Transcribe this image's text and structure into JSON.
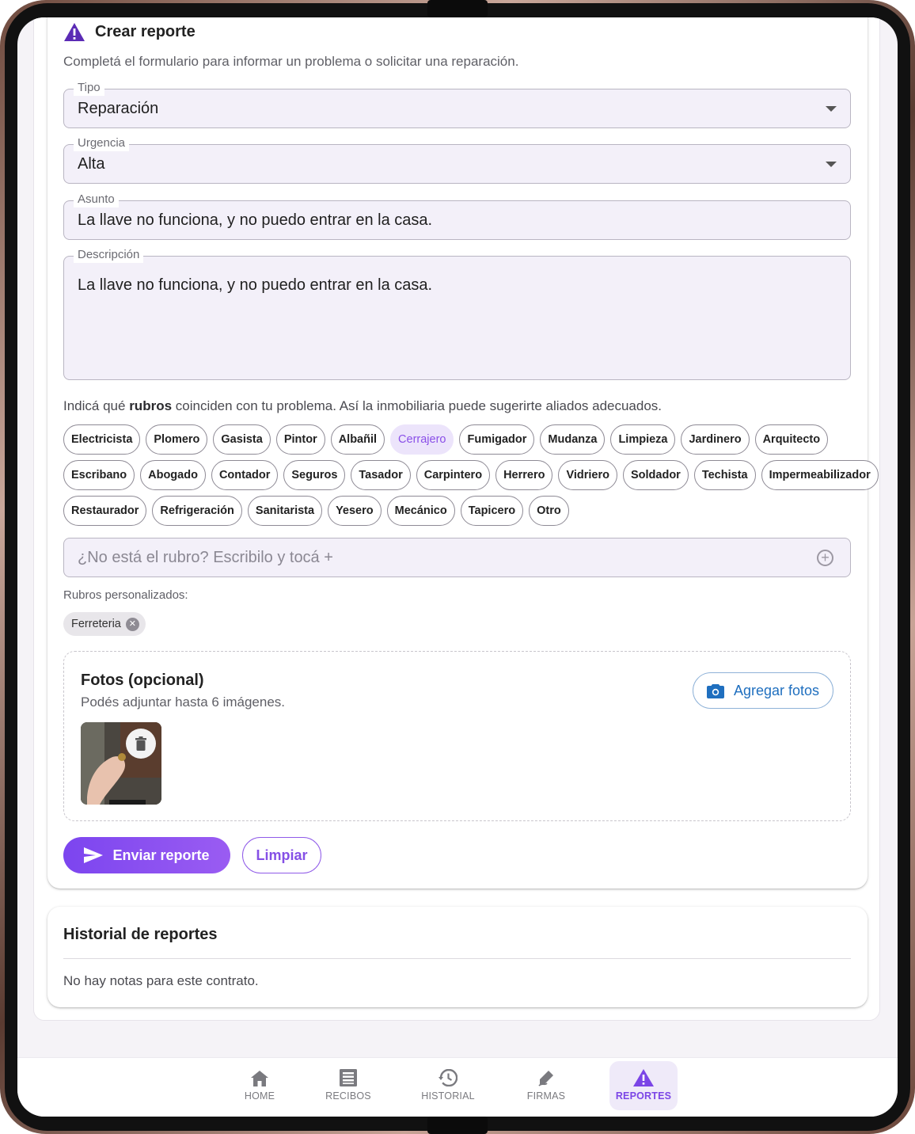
{
  "form": {
    "title": "Crear reporte",
    "subtitle": "Completá el formulario para informar un problema o solicitar una reparación.",
    "tipo": {
      "label": "Tipo",
      "value": "Reparación"
    },
    "urgencia": {
      "label": "Urgencia",
      "value": "Alta"
    },
    "asunto": {
      "label": "Asunto",
      "value": "La llave no funciona, y no puedo entrar en la casa."
    },
    "descripcion": {
      "label": "Descripción",
      "value": "La llave no funciona, y no puedo entrar en la casa."
    },
    "rubros_hint_pre": "Indicá qué ",
    "rubros_hint_bold": "rubros",
    "rubros_hint_post": " coinciden con tu problema. Así la inmobiliaria puede sugerirte aliados adecuados.",
    "rubros_row1": [
      "Electricista",
      "Plomero",
      "Gasista",
      "Pintor",
      "Albañil",
      "Cerrajero",
      "Fumigador",
      "Mudanza",
      "Limpieza",
      "Jardinero",
      "Arquitecto"
    ],
    "rubros_row2": [
      "Escribano",
      "Abogado",
      "Contador",
      "Seguros",
      "Tasador",
      "Carpintero",
      "Herrero",
      "Vidriero",
      "Soldador",
      "Techista",
      "Impermeabilizador"
    ],
    "rubros_row3": [
      "Restaurador",
      "Refrigeración",
      "Sanitarista",
      "Yesero",
      "Mecánico",
      "Tapicero",
      "Otro"
    ],
    "selected_rubro": "Cerrajero",
    "custom_placeholder": "¿No está el rubro? Escribilo y tocá +",
    "custom_label": "Rubros personalizados:",
    "custom_chip": "Ferreteria",
    "fotos_title": "Fotos (opcional)",
    "fotos_sub": "Podés adjuntar hasta 6 imágenes.",
    "agregar_fotos": "Agregar fotos",
    "enviar": "Enviar reporte",
    "limpiar": "Limpiar"
  },
  "historial": {
    "title": "Historial de reportes",
    "empty": "No hay notas para este contrato."
  },
  "nav": [
    {
      "label": "HOME",
      "icon": "home-icon"
    },
    {
      "label": "RECIBOS",
      "icon": "receipt-icon"
    },
    {
      "label": "HISTORIAL",
      "icon": "history-icon"
    },
    {
      "label": "FIRMAS",
      "icon": "signature-icon"
    },
    {
      "label": "REPORTES",
      "icon": "warning-icon",
      "active": true
    }
  ],
  "colors": {
    "accent": "#7b45e6",
    "link_blue": "#1f6fbf"
  }
}
